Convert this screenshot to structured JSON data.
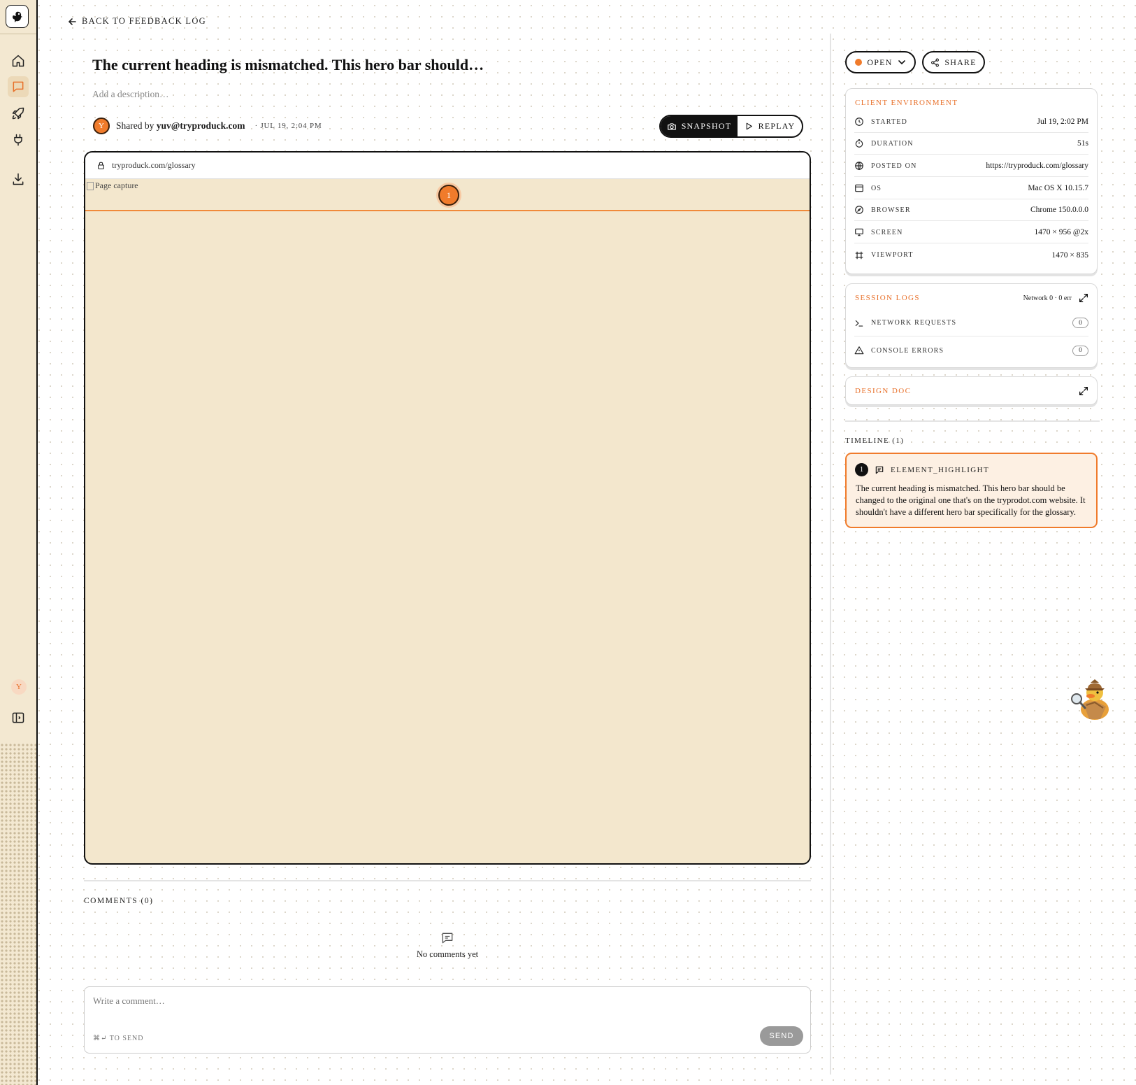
{
  "nav": {
    "back_label": "BACK TO FEEDBACK LOG",
    "avatar_initial": "Y"
  },
  "feedback": {
    "title": "The current heading is mismatched. This hero bar should…",
    "description_placeholder": "Add a description…",
    "shared_prefix": "Shared by",
    "author": "yuv@tryproduck.com",
    "author_initial": "Y",
    "date": "· JUL 19, 2:04 PM"
  },
  "view_toggle": {
    "snapshot_label": "SNAPSHOT",
    "replay_label": "REPLAY",
    "active": "snapshot"
  },
  "browser": {
    "url": "tryproduck.com/glossary",
    "image_alt": "Page capture",
    "marker_number": "1"
  },
  "comments": {
    "title": "COMMENTS (0)",
    "empty_text": "No comments yet",
    "input_placeholder": "Write a comment…",
    "hint": "⌘↵ TO SEND",
    "send_label": "SEND"
  },
  "status": {
    "label": "OPEN",
    "color": "#f07b2b"
  },
  "share_label": "SHARE",
  "environment": {
    "title": "CLIENT ENVIRONMENT",
    "rows": [
      {
        "icon": "clock-icon",
        "label": "STARTED",
        "value": "Jul 19, 2:02 PM"
      },
      {
        "icon": "timer-icon",
        "label": "DURATION",
        "value": "51s"
      },
      {
        "icon": "globe-icon",
        "label": "POSTED ON",
        "value": "https://tryproduck.com/glossary"
      },
      {
        "icon": "window-icon",
        "label": "OS",
        "value": "Mac OS X 10.15.7"
      },
      {
        "icon": "compass-icon",
        "label": "BROWSER",
        "value": "Chrome 150.0.0.0"
      },
      {
        "icon": "monitor-icon",
        "label": "SCREEN",
        "value": "1470 × 956 @2x"
      },
      {
        "icon": "frame-icon",
        "label": "VIEWPORT",
        "value": "1470 × 835"
      }
    ]
  },
  "session_logs": {
    "title": "SESSION LOGS",
    "summary": "Network 0 · 0 err",
    "network_label": "NETWORK REQUESTS",
    "network_count": "0",
    "console_label": "CONSOLE ERRORS",
    "console_count": "0"
  },
  "design_doc": {
    "title": "DESIGN DOC"
  },
  "timeline": {
    "title": "TIMELINE (1)",
    "items": [
      {
        "number": "1",
        "type": "ELEMENT_HIGHLIGHT",
        "text": "The current heading is mismatched. This hero bar should be changed to the original one that's on the tryprodot.com website. It shouldn't have a different hero bar specifically for the glossary."
      }
    ]
  },
  "colors": {
    "accent": "#f07b2b",
    "sidebar_bg": "#f3e8d1",
    "capture_bg": "#f3e7cd"
  }
}
